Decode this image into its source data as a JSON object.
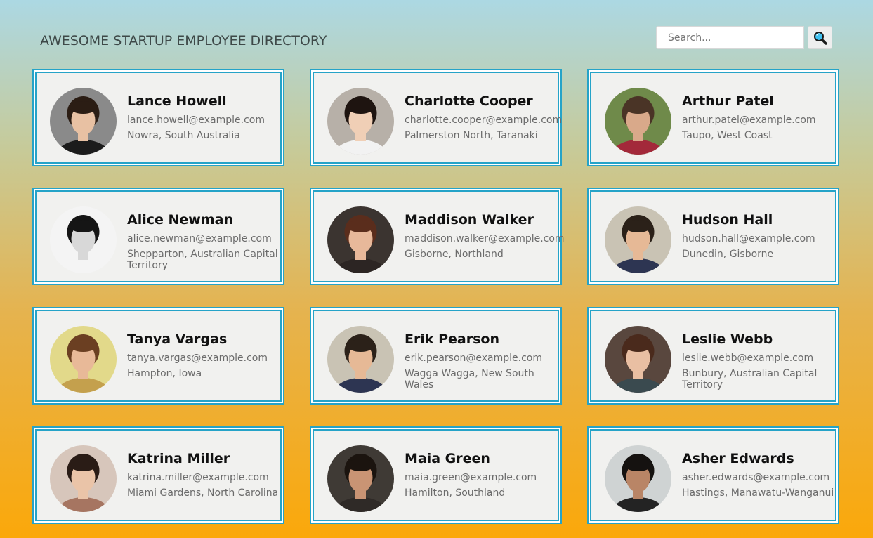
{
  "header": {
    "title": "AWESOME STARTUP EMPLOYEE DIRECTORY"
  },
  "search": {
    "placeholder": "Search...",
    "value": "",
    "button_icon": "search-icon"
  },
  "colors": {
    "card_border": "#25a3c8",
    "card_background": "#f1f1ef",
    "gradient_top": "#acd8e3",
    "gradient_bottom": "#fba80a"
  },
  "employees": [
    {
      "name": "Lance Howell",
      "email": "lance.howell@example.com",
      "location": "Nowra, South Australia"
    },
    {
      "name": "Charlotte Cooper",
      "email": "charlotte.cooper@example.com",
      "location": "Palmerston North, Taranaki"
    },
    {
      "name": "Arthur Patel",
      "email": "arthur.patel@example.com",
      "location": "Taupo, West Coast"
    },
    {
      "name": "Alice Newman",
      "email": "alice.newman@example.com",
      "location": "Shepparton, Australian Capital Territory"
    },
    {
      "name": "Maddison Walker",
      "email": "maddison.walker@example.com",
      "location": "Gisborne, Northland"
    },
    {
      "name": "Hudson Hall",
      "email": "hudson.hall@example.com",
      "location": "Dunedin, Gisborne"
    },
    {
      "name": "Tanya Vargas",
      "email": "tanya.vargas@example.com",
      "location": "Hampton, Iowa"
    },
    {
      "name": "Erik Pearson",
      "email": "erik.pearson@example.com",
      "location": "Wagga Wagga, New South Wales"
    },
    {
      "name": "Leslie Webb",
      "email": "leslie.webb@example.com",
      "location": "Bunbury, Australian Capital Territory"
    },
    {
      "name": "Katrina Miller",
      "email": "katrina.miller@example.com",
      "location": "Miami Gardens, North Carolina"
    },
    {
      "name": "Maia Green",
      "email": "maia.green@example.com",
      "location": "Hamilton, Southland"
    },
    {
      "name": "Asher Edwards",
      "email": "asher.edwards@example.com",
      "location": "Hastings, Manawatu-Wanganui"
    }
  ]
}
